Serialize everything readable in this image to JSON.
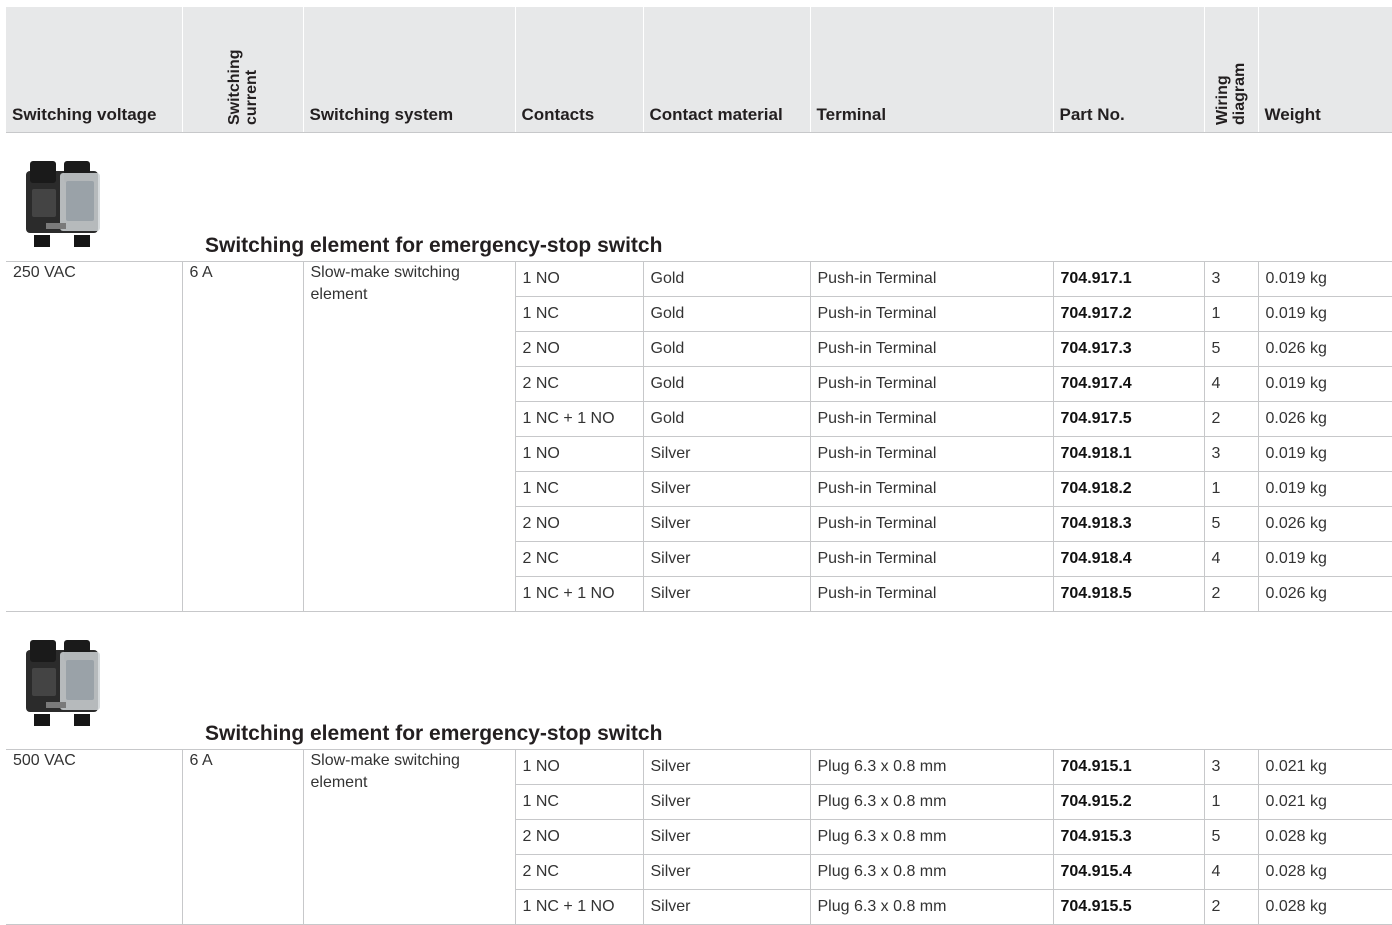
{
  "headers": {
    "switching_voltage": "Switching voltage",
    "switching_current": "Switching current",
    "switching_system": "Switching system",
    "contacts": "Contacts",
    "contact_material": "Contact material",
    "terminal": "Terminal",
    "part_no": "Part No.",
    "wiring_diagram": "Wiring diagram",
    "weight": "Weight"
  },
  "sections": [
    {
      "title": "Switching element for emergency-stop switch",
      "image_icon": "switching-element-photo",
      "voltage": "250 VAC",
      "current": "6 A",
      "system": "Slow-make switching element",
      "rows": [
        {
          "contacts": "1 NO",
          "material": "Gold",
          "terminal": "Push-in Terminal",
          "part": "704.917.1",
          "wiring": "3",
          "weight": "0.019 kg"
        },
        {
          "contacts": "1 NC",
          "material": "Gold",
          "terminal": "Push-in Terminal",
          "part": "704.917.2",
          "wiring": "1",
          "weight": "0.019 kg"
        },
        {
          "contacts": "2 NO",
          "material": "Gold",
          "terminal": "Push-in Terminal",
          "part": "704.917.3",
          "wiring": "5",
          "weight": "0.026 kg"
        },
        {
          "contacts": "2 NC",
          "material": "Gold",
          "terminal": "Push-in Terminal",
          "part": "704.917.4",
          "wiring": "4",
          "weight": "0.019 kg"
        },
        {
          "contacts": "1 NC + 1 NO",
          "material": "Gold",
          "terminal": "Push-in Terminal",
          "part": "704.917.5",
          "wiring": "2",
          "weight": "0.026 kg"
        },
        {
          "contacts": "1 NO",
          "material": "Silver",
          "terminal": "Push-in Terminal",
          "part": "704.918.1",
          "wiring": "3",
          "weight": "0.019 kg"
        },
        {
          "contacts": "1 NC",
          "material": "Silver",
          "terminal": "Push-in Terminal",
          "part": "704.918.2",
          "wiring": "1",
          "weight": "0.019 kg"
        },
        {
          "contacts": "2 NO",
          "material": "Silver",
          "terminal": "Push-in Terminal",
          "part": "704.918.3",
          "wiring": "5",
          "weight": "0.026 kg"
        },
        {
          "contacts": "2 NC",
          "material": "Silver",
          "terminal": "Push-in Terminal",
          "part": "704.918.4",
          "wiring": "4",
          "weight": "0.019 kg"
        },
        {
          "contacts": "1 NC + 1 NO",
          "material": "Silver",
          "terminal": "Push-in Terminal",
          "part": "704.918.5",
          "wiring": "2",
          "weight": "0.026 kg"
        }
      ]
    },
    {
      "title": "Switching element for emergency-stop switch",
      "image_icon": "switching-element-photo",
      "voltage": "500 VAC",
      "current": "6 A",
      "system": "Slow-make switching element",
      "rows": [
        {
          "contacts": "1 NO",
          "material": "Silver",
          "terminal": "Plug 6.3 x 0.8 mm",
          "part": "704.915.1",
          "wiring": "3",
          "weight": "0.021 kg"
        },
        {
          "contacts": "1 NC",
          "material": "Silver",
          "terminal": "Plug 6.3 x 0.8 mm",
          "part": "704.915.2",
          "wiring": "1",
          "weight": "0.021 kg"
        },
        {
          "contacts": "2 NO",
          "material": "Silver",
          "terminal": "Plug 6.3 x 0.8 mm",
          "part": "704.915.3",
          "wiring": "5",
          "weight": "0.028 kg"
        },
        {
          "contacts": "2 NC",
          "material": "Silver",
          "terminal": "Plug 6.3 x 0.8 mm",
          "part": "704.915.4",
          "wiring": "4",
          "weight": "0.028 kg"
        },
        {
          "contacts": "1 NC + 1 NO",
          "material": "Silver",
          "terminal": "Plug 6.3 x 0.8 mm",
          "part": "704.915.5",
          "wiring": "2",
          "weight": "0.028 kg"
        }
      ]
    }
  ]
}
